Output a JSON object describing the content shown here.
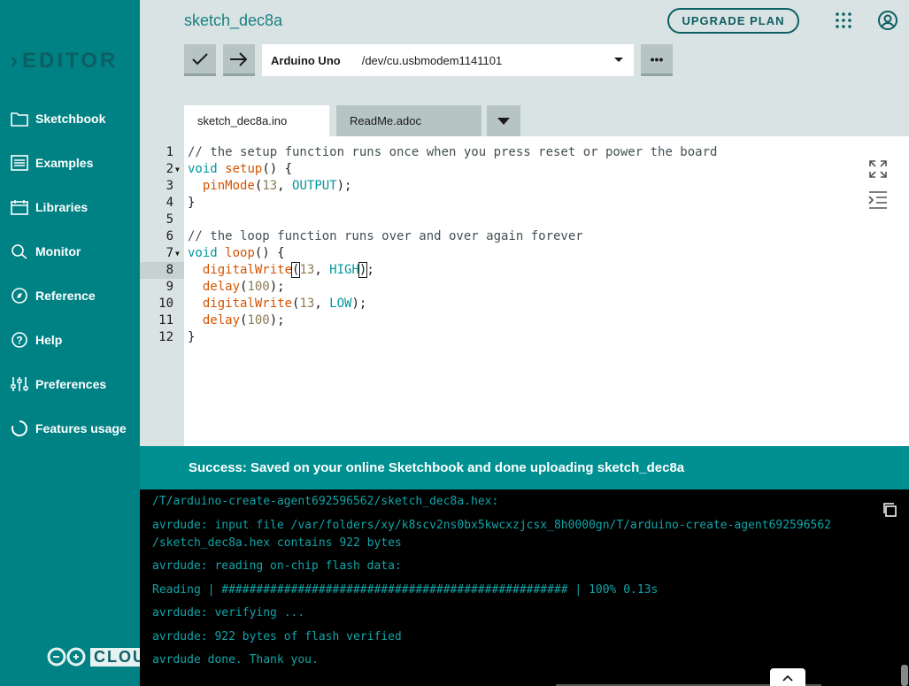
{
  "sidebar": {
    "logo": "EDITOR",
    "items": [
      {
        "label": "Sketchbook",
        "icon": "folder-icon"
      },
      {
        "label": "Examples",
        "icon": "list-icon"
      },
      {
        "label": "Libraries",
        "icon": "library-icon"
      },
      {
        "label": "Monitor",
        "icon": "monitor-icon"
      },
      {
        "label": "Reference",
        "icon": "compass-icon"
      },
      {
        "label": "Help",
        "icon": "help-icon"
      },
      {
        "label": "Preferences",
        "icon": "sliders-icon"
      },
      {
        "label": "Features usage",
        "icon": "usage-icon"
      }
    ],
    "cloud_label": "CLOU"
  },
  "header": {
    "sketch_title": "sketch_dec8a",
    "upgrade_label": "UPGRADE PLAN",
    "board_name": "Arduino Uno",
    "port": "/dev/cu.usbmodem1141101",
    "more_label": "•••"
  },
  "tabs": [
    {
      "label": "sketch_dec8a.ino",
      "active": true
    },
    {
      "label": "ReadMe.adoc",
      "active": false
    }
  ],
  "editor": {
    "active_line": 8,
    "lines": [
      {
        "n": "1",
        "fold": false
      },
      {
        "n": "2",
        "fold": true
      },
      {
        "n": "3",
        "fold": false
      },
      {
        "n": "4",
        "fold": false
      },
      {
        "n": "5",
        "fold": false
      },
      {
        "n": "6",
        "fold": false
      },
      {
        "n": "7",
        "fold": true
      },
      {
        "n": "8",
        "fold": false
      },
      {
        "n": "9",
        "fold": false
      },
      {
        "n": "10",
        "fold": false
      },
      {
        "n": "11",
        "fold": false
      },
      {
        "n": "12",
        "fold": false
      }
    ],
    "code": {
      "l1": "// the setup function runs once when you press reset or power the board",
      "l2_kw": "void",
      "l2_fn": "setup",
      "l2_rest": "() {",
      "l3_fn": "pinMode",
      "l3_num": "13",
      "l3_cst": "OUTPUT",
      "l4": "}",
      "l6": "// the loop function runs over and over again forever",
      "l7_kw": "void",
      "l7_fn": "loop",
      "l7_rest": "() {",
      "l8_fn": "digitalWrite",
      "l8_num": "13",
      "l8_cst": "HIGH",
      "l9_fn": "delay",
      "l9_num": "100",
      "l10_fn": "digitalWrite",
      "l10_num": "13",
      "l10_cst": "LOW",
      "l11_fn": "delay",
      "l11_num": "100",
      "l12": "}"
    }
  },
  "status": {
    "message": "Success: Saved on your online Sketchbook and done uploading sketch_dec8a"
  },
  "console": {
    "lines": [
      "/T/arduino-create-agent692596562/sketch_dec8a.hex:",
      "avrdude: input file /var/folders/xy/k8scv2ns0bx5kwcxzjcsx_8h0000gn/T/arduino-create-agent692596562",
      "/sketch_dec8a.hex contains 922 bytes",
      "avrdude: reading on-chip flash data:",
      "Reading | ################################################## | 100% 0.13s",
      "avrdude: verifying ...",
      "avrdude: 922 bytes of flash verified",
      "avrdude done. Thank you."
    ]
  },
  "colors": {
    "sidebar_bg": "#008184",
    "header_bg": "#dae3e3",
    "status_bg": "#009092",
    "console_text": "#12a4a8"
  }
}
